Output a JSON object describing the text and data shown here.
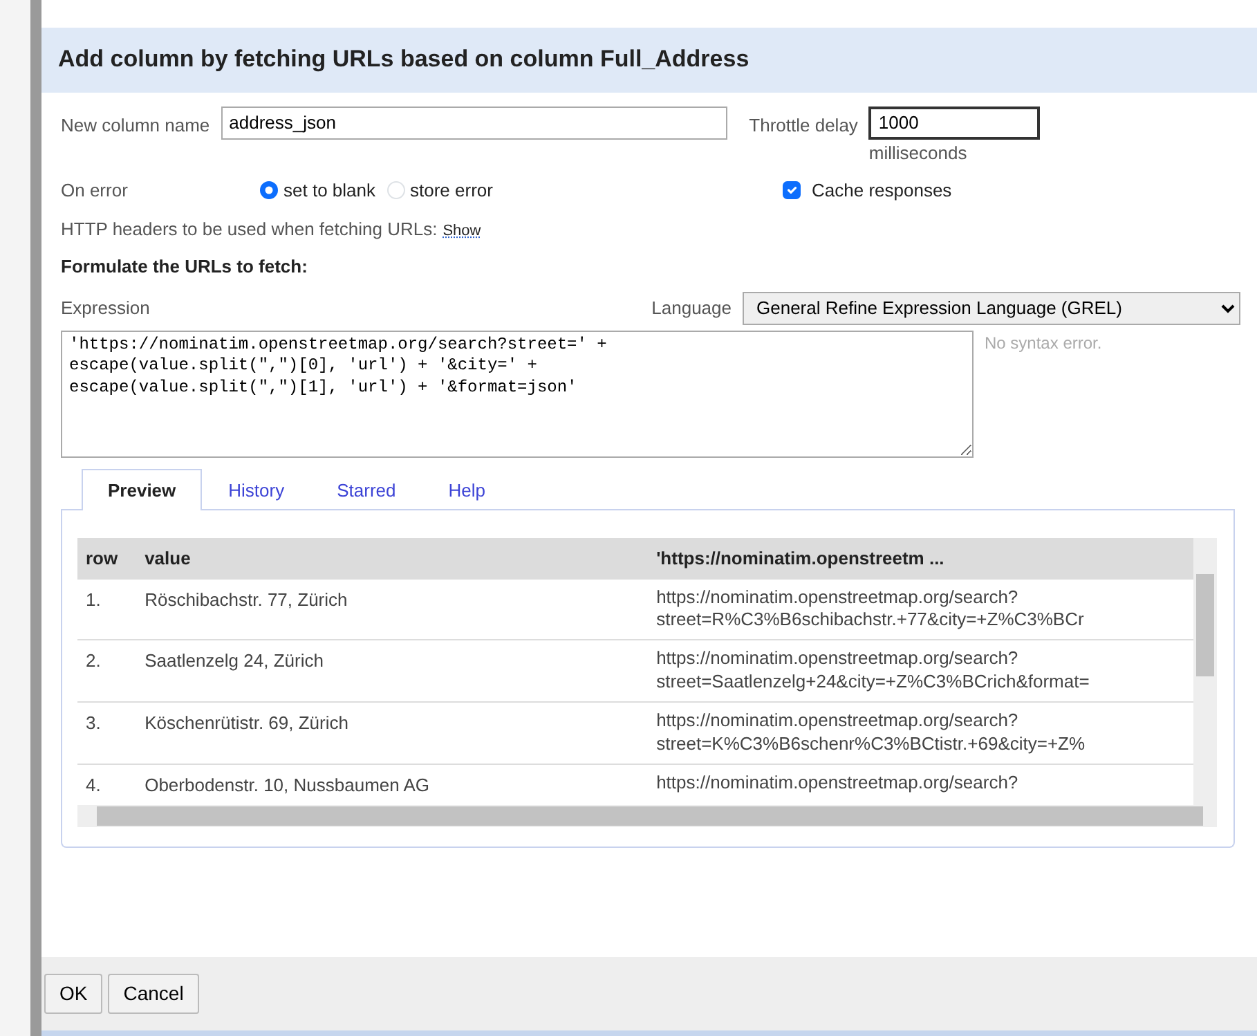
{
  "dialog": {
    "title": "Add column by fetching URLs based on column Full_Address"
  },
  "new_column": {
    "label": "New column name",
    "value": "address_json"
  },
  "throttle": {
    "label": "Throttle delay",
    "value": "1000",
    "unit": "milliseconds"
  },
  "on_error": {
    "label": "On error",
    "options": [
      {
        "label": "set to blank",
        "selected": true
      },
      {
        "label": "store error",
        "selected": false
      }
    ]
  },
  "cache": {
    "label": "Cache responses",
    "checked": true
  },
  "headers": {
    "text": "HTTP headers to be used when fetching URLs:",
    "link": "Show"
  },
  "formulate_heading": "Formulate the URLs to fetch:",
  "expression": {
    "label": "Expression",
    "value": "'https://nominatim.openstreetmap.org/search?street=' +\nescape(value.split(\",\")[0], 'url') + '&city=' +\nescape(value.split(\",\")[1], 'url') + '&format=json'",
    "status": "No syntax error."
  },
  "language": {
    "label": "Language",
    "value": "General Refine Expression Language (GREL)"
  },
  "tabs": [
    {
      "label": "Preview",
      "selected": true
    },
    {
      "label": "History",
      "selected": false
    },
    {
      "label": "Starred",
      "selected": false
    },
    {
      "label": "Help",
      "selected": false
    }
  ],
  "preview": {
    "columns": [
      "row",
      "value",
      "'https://nominatim.openstreetm ..."
    ],
    "rows": [
      {
        "row": "1.",
        "value": "Röschibachstr. 77, Zürich",
        "result": [
          "https://nominatim.openstreetmap.org/search?",
          "street=R%C3%B6schibachstr.+77&city=+Z%C3%BCr"
        ]
      },
      {
        "row": "2.",
        "value": "Saatlenzelg 24, Zürich",
        "result": [
          "https://nominatim.openstreetmap.org/search?",
          "street=Saatlenzelg+24&city=+Z%C3%BCrich&format="
        ]
      },
      {
        "row": "3.",
        "value": "Köschenrütistr. 69, Zürich",
        "result": [
          "https://nominatim.openstreetmap.org/search?",
          "street=K%C3%B6schenr%C3%BCtistr.+69&city=+Z%"
        ]
      },
      {
        "row": "4.",
        "value": "Oberbodenstr. 10, Nussbaumen AG",
        "result": [
          "https://nominatim.openstreetmap.org/search?"
        ]
      }
    ]
  },
  "buttons": [
    "OK",
    "Cancel"
  ]
}
